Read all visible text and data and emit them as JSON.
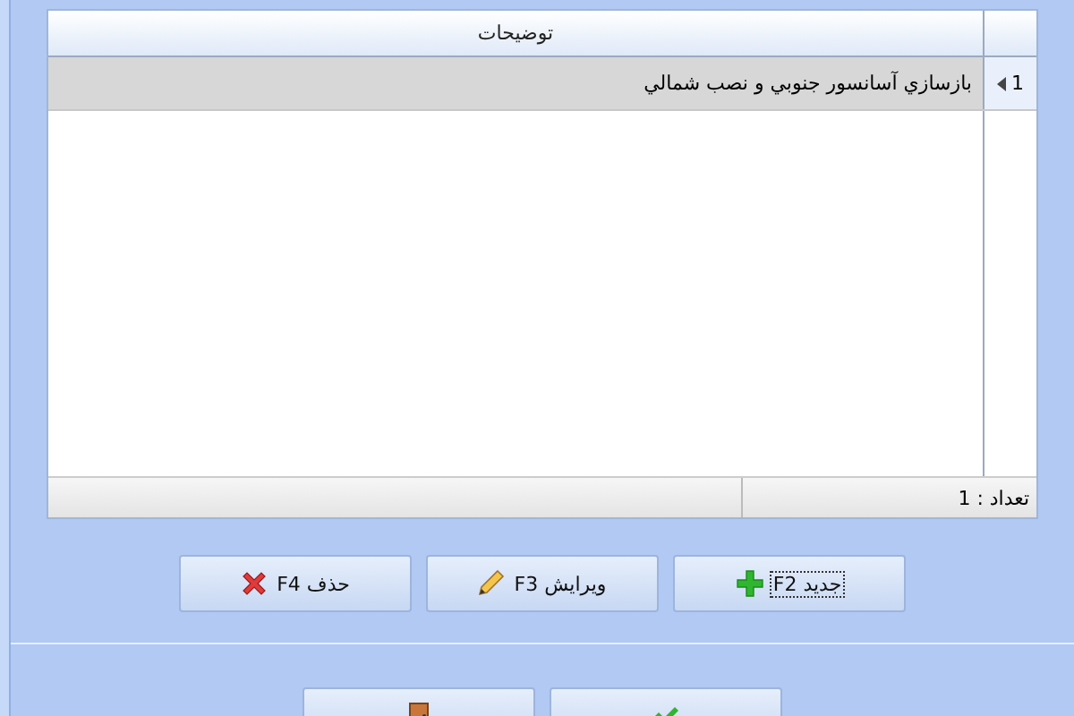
{
  "grid": {
    "columns": [
      "توضیحات"
    ],
    "rows": [
      {
        "number": "1",
        "description": "بازسازي آسانسور جنوبي و نصب شمالي",
        "selected": true
      }
    ],
    "footer": "تعداد : 1"
  },
  "buttons": [
    {
      "kind": "add",
      "label": "جدید F2",
      "focused": true
    },
    {
      "kind": "edit",
      "label": "ویرایش F3",
      "focused": false
    },
    {
      "kind": "delete",
      "label": "حذف F4",
      "focused": false
    }
  ],
  "bottom_buttons": [
    {
      "kind": "confirm"
    },
    {
      "kind": "exit"
    }
  ]
}
